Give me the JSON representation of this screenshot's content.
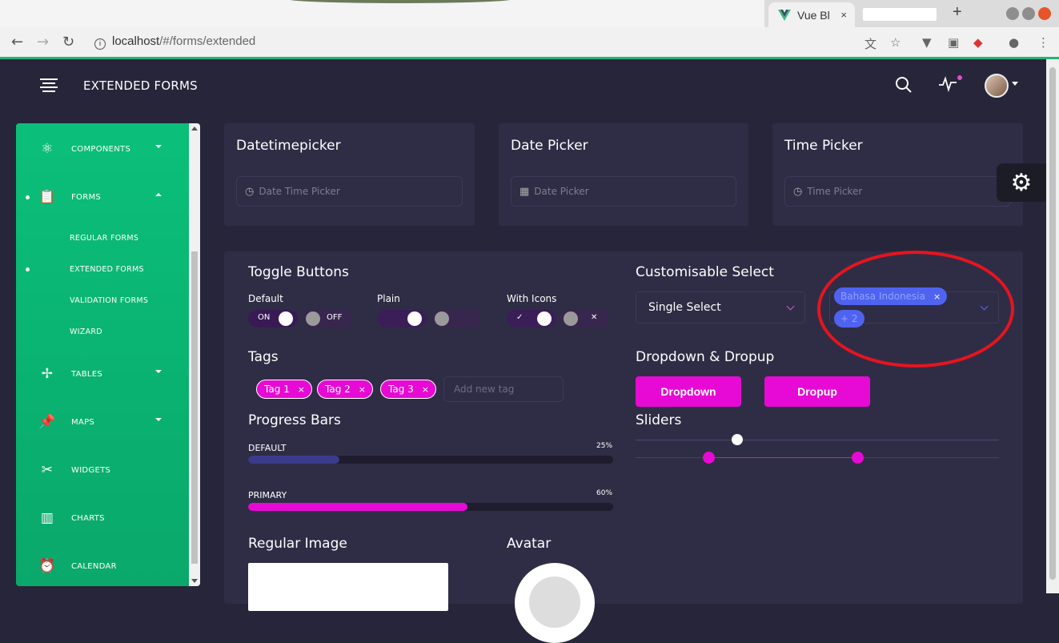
{
  "browser": {
    "tab_title": "Vue Bl",
    "tab_close": "×",
    "new_tab": "+",
    "url_host": "localhost",
    "url_path": "/#/forms/extended"
  },
  "topbar": {
    "title": "EXTENDED FORMS"
  },
  "sidebar": {
    "items": [
      {
        "label": "COMPONENTS",
        "icon": "atom-icon",
        "caret": "down"
      },
      {
        "label": "FORMS",
        "icon": "clipboard-icon",
        "caret": "up",
        "active": true
      },
      {
        "label": "TABLES",
        "icon": "puzzle-icon",
        "caret": "down"
      },
      {
        "label": "MAPS",
        "icon": "pin-icon",
        "caret": "down"
      },
      {
        "label": "WIDGETS",
        "icon": "tools-icon"
      },
      {
        "label": "CHARTS",
        "icon": "chart-bars-icon"
      },
      {
        "label": "CALENDAR",
        "icon": "alarm-clock-icon"
      }
    ],
    "sub_items": [
      "REGULAR FORMS",
      "EXTENDED FORMS",
      "VALIDATION FORMS",
      "WIZARD"
    ]
  },
  "pickers": {
    "datetime": {
      "title": "Datetimepicker",
      "placeholder": "Date Time Picker"
    },
    "date": {
      "title": "Date Picker",
      "placeholder": "Date Picker"
    },
    "time": {
      "title": "Time Picker",
      "placeholder": "Time Picker"
    }
  },
  "toggles": {
    "title": "Toggle Buttons",
    "default_label": "Default",
    "plain_label": "Plain",
    "icons_label": "With Icons",
    "on_text": "ON",
    "off_text": "OFF",
    "check": "✓",
    "cross": "✕"
  },
  "tags": {
    "title": "Tags",
    "items": [
      "Tag 1",
      "Tag 2",
      "Tag 3"
    ],
    "remove": "×",
    "input_placeholder": "Add new tag"
  },
  "progress": {
    "title": "Progress Bars",
    "bars": [
      {
        "label": "DEFAULT",
        "percent_text": "25%",
        "value": 25,
        "color": "#3a3b8a"
      },
      {
        "label": "PRIMARY",
        "percent_text": "60%",
        "value": 60,
        "color": "#e60ad4"
      }
    ]
  },
  "select": {
    "title": "Customisable Select",
    "single_value": "Single Select",
    "multi_chip": "Bahasa Indonesia",
    "multi_more": "+ 2",
    "chip_remove": "×"
  },
  "dropdown": {
    "title": "Dropdown & Dropup",
    "dropdown_label": "Dropdown",
    "dropup_label": "Dropup"
  },
  "sliders": {
    "title": "Sliders",
    "single_value": 0.28,
    "range_values": [
      0.2,
      0.61
    ]
  },
  "media": {
    "image_title": "Regular Image",
    "avatar_title": "Avatar"
  },
  "colors": {
    "accent": "#e60ad4",
    "sidebar": "#0bbf7a",
    "background": "#27253a",
    "card": "#2f2d45",
    "highlight": "#e6141f"
  }
}
